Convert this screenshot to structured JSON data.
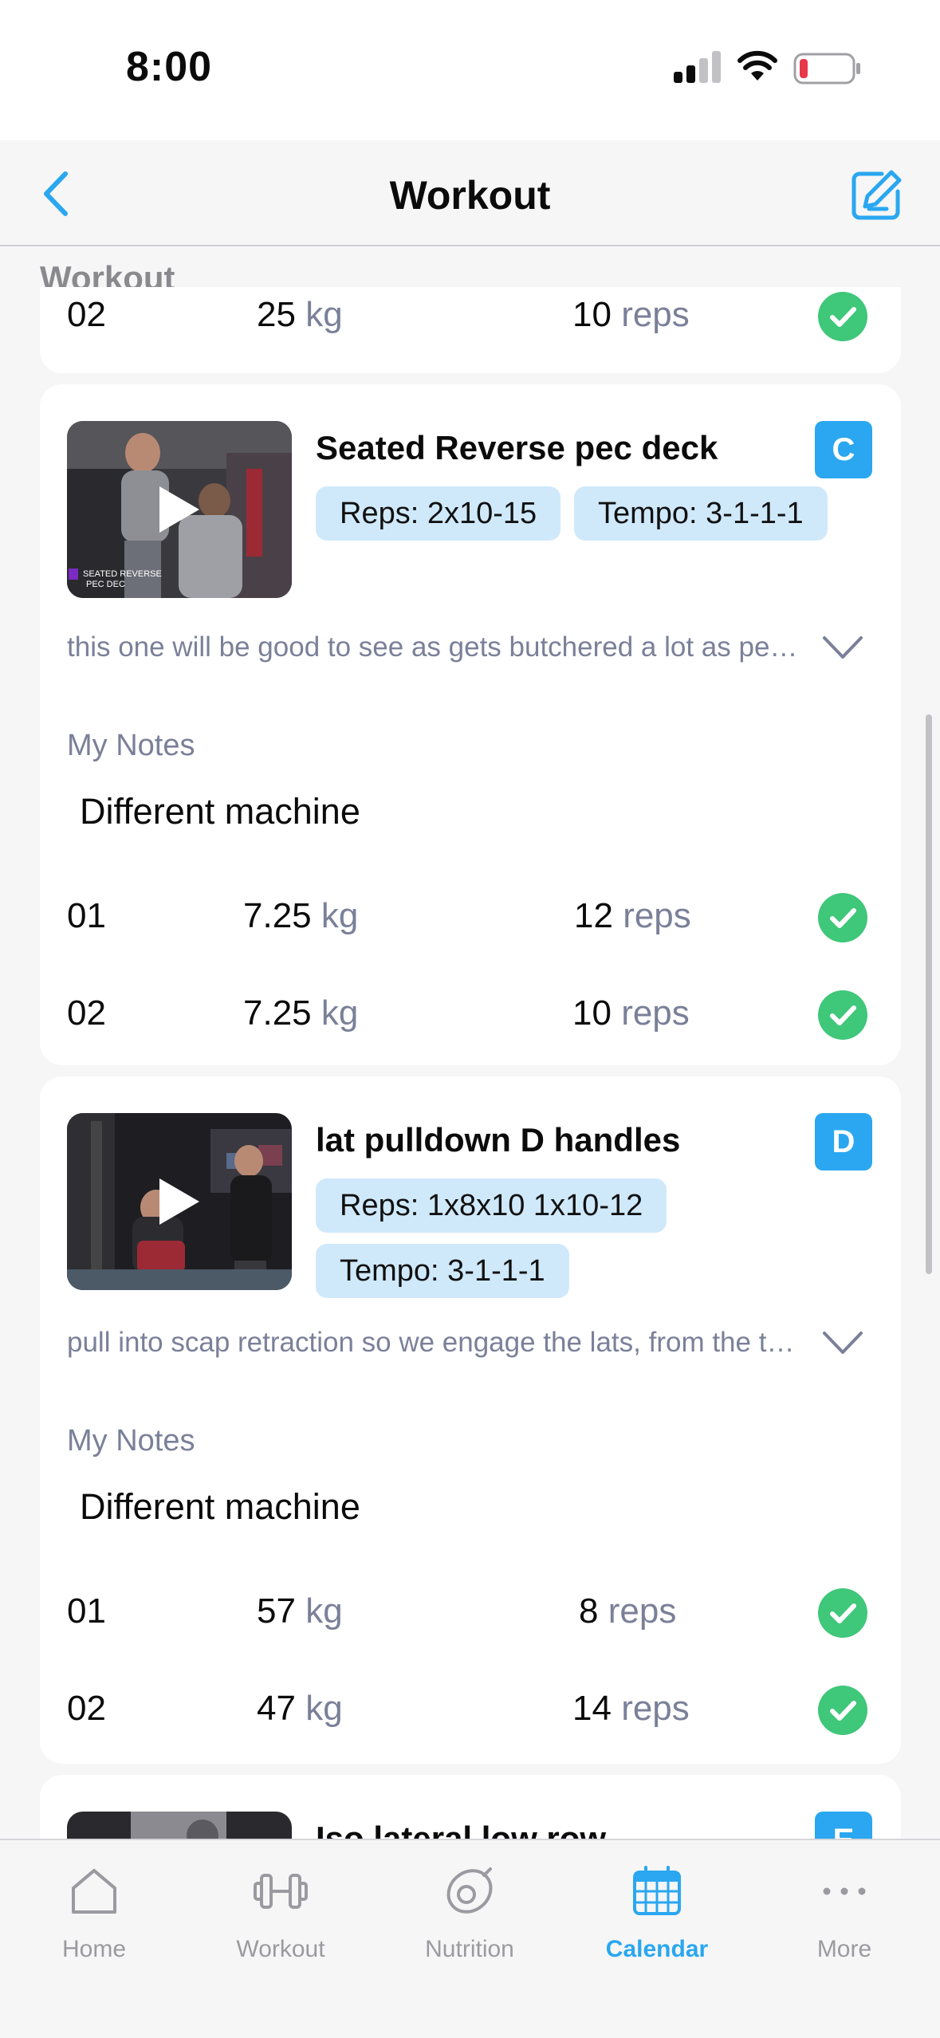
{
  "status_bar": {
    "time": "8:00"
  },
  "header": {
    "title": "Workout"
  },
  "section": {
    "label": "Workout"
  },
  "previous_card": {
    "set": {
      "no": "02",
      "weight": "25",
      "weight_unit": "kg",
      "reps": "10",
      "reps_unit": "reps"
    }
  },
  "exercises": [
    {
      "title": "Seated Reverse pec deck",
      "letter": "C",
      "chips": [
        "Reps: 2x10-15",
        "Tempo: 3-1-1-1"
      ],
      "thumb_caption": "SEATED REVERSE PEC DEC",
      "description": "this one will be good to see as gets butchered a lot as people just push back wi...",
      "notes_label": "My Notes",
      "notes": "Different machine",
      "sets": [
        {
          "no": "01",
          "weight": "7.25",
          "weight_unit": "kg",
          "reps": "12",
          "reps_unit": "reps"
        },
        {
          "no": "02",
          "weight": "7.25",
          "weight_unit": "kg",
          "reps": "10",
          "reps_unit": "reps"
        }
      ]
    },
    {
      "title": "lat pulldown D handles",
      "letter": "D",
      "chips": [
        "Reps: 1x8x10 1x10-12",
        "Tempo: 3-1-1-1"
      ],
      "description": "pull into scap retraction so we engage the lats, from the top position extend fully",
      "notes_label": "My Notes",
      "notes": "Different machine",
      "sets": [
        {
          "no": "01",
          "weight": "57",
          "weight_unit": "kg",
          "reps": "8",
          "reps_unit": "reps"
        },
        {
          "no": "02",
          "weight": "47",
          "weight_unit": "kg",
          "reps": "14",
          "reps_unit": "reps"
        }
      ]
    },
    {
      "title": "Iso lateral low row",
      "letter": "E"
    }
  ],
  "tabs": [
    {
      "label": "Home",
      "icon": "home-icon"
    },
    {
      "label": "Workout",
      "icon": "dumbbell-icon"
    },
    {
      "label": "Nutrition",
      "icon": "avocado-icon"
    },
    {
      "label": "Calendar",
      "icon": "calendar-icon",
      "active": true
    },
    {
      "label": "More",
      "icon": "more-icon"
    }
  ],
  "colors": {
    "accent": "#2aa7f0",
    "check": "#3fc77a",
    "chip": "#cfe9fb",
    "muted": "#7b8099"
  }
}
